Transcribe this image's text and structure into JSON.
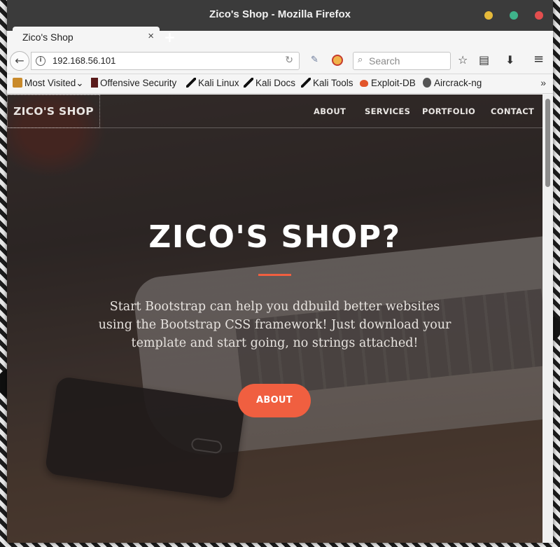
{
  "window": {
    "title": "Zico's Shop - Mozilla Firefox"
  },
  "tabs": [
    {
      "label": "Zico's Shop",
      "close": "×"
    }
  ],
  "new_tab": "+",
  "navbar": {
    "back": "←",
    "url": "192.168.56.101",
    "info": "i",
    "reload": "↻",
    "search_placeholder": "Search",
    "search_icon": "⌕",
    "star": "☆",
    "reading_list": "▤",
    "download": "⬇",
    "menu": "≡"
  },
  "bookmarks": {
    "items": [
      {
        "label": "Most Visited",
        "suffix": "⌄"
      },
      {
        "label": "Offensive Security"
      },
      {
        "label": "Kali Linux"
      },
      {
        "label": "Kali Docs"
      },
      {
        "label": "Kali Tools"
      },
      {
        "label": "Exploit-DB"
      },
      {
        "label": "Aircrack-ng"
      }
    ],
    "more": "»"
  },
  "site": {
    "brand": "ZICO'S SHOP",
    "nav": [
      "ABOUT",
      "SERVICES",
      "PORTFOLIO",
      "CONTACT"
    ],
    "hero_title": "ZICO'S SHOP?",
    "hero_text": "Start Bootstrap can help you ddbuild better websites using the Bootstrap CSS framework! Just download your template and start going, no strings attached!",
    "cta": "ABOUT"
  },
  "colors": {
    "accent": "#f05f40",
    "titlebar": "#3b3b3b"
  }
}
